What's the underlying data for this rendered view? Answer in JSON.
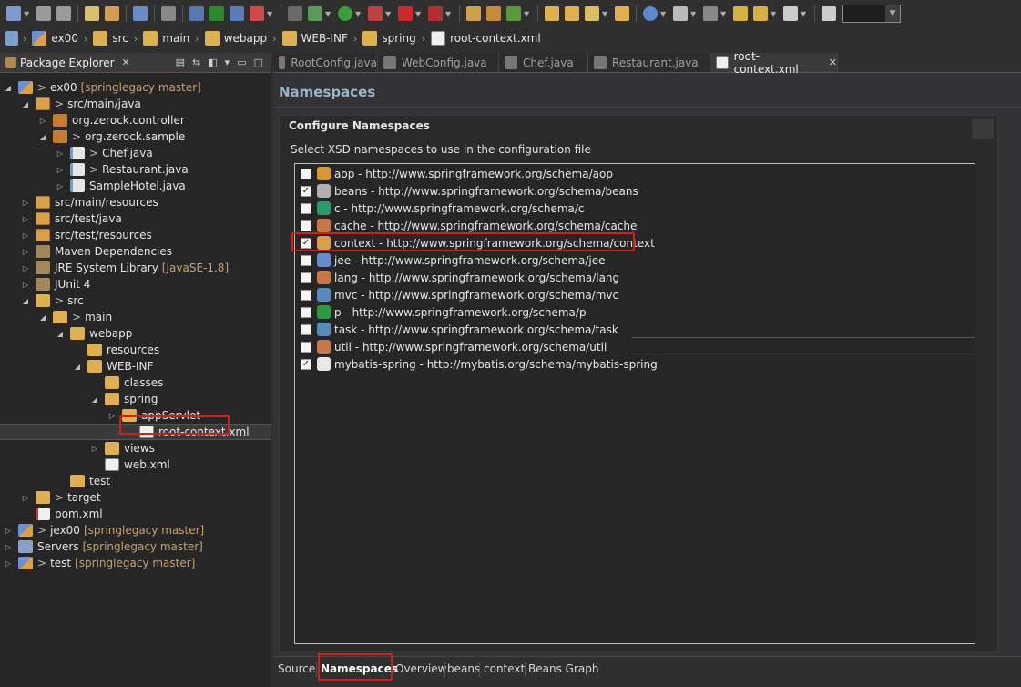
{
  "breadcrumb": [
    "ex00",
    "src",
    "main",
    "webapp",
    "WEB-INF",
    "spring",
    "root-context.xml"
  ],
  "explorer": {
    "title": "Package Explorer",
    "items": [
      {
        "label": "ex00",
        "deco": "[springlegacy master]",
        "prefix": ">",
        "icon": "project-icon",
        "arrow": "expanded"
      },
      {
        "label": "src/main/java",
        "prefix": ">",
        "icon": "source-folder-icon",
        "arrow": "expanded"
      },
      {
        "label": "org.zerock.controller",
        "icon": "package-icon",
        "arrow": "collapsed"
      },
      {
        "label": "org.zerock.sample",
        "prefix": ">",
        "icon": "package-icon",
        "arrow": "expanded"
      },
      {
        "label": "Chef.java",
        "prefix": ">",
        "icon": "java-file-icon",
        "arrow": "collapsed"
      },
      {
        "label": "Restaurant.java",
        "prefix": ">",
        "icon": "java-file-icon",
        "arrow": "collapsed"
      },
      {
        "label": "SampleHotel.java",
        "icon": "java-file-icon",
        "arrow": "collapsed"
      },
      {
        "label": "src/main/resources",
        "icon": "source-folder-icon",
        "arrow": "collapsed"
      },
      {
        "label": "src/test/java",
        "icon": "source-folder-icon",
        "arrow": "collapsed"
      },
      {
        "label": "src/test/resources",
        "icon": "source-folder-icon",
        "arrow": "collapsed"
      },
      {
        "label": "Maven Dependencies",
        "icon": "library-icon",
        "arrow": "collapsed"
      },
      {
        "label": "JRE System Library",
        "deco": "[JavaSE-1.8]",
        "icon": "library-icon",
        "arrow": "collapsed"
      },
      {
        "label": "JUnit 4",
        "icon": "library-icon",
        "arrow": "collapsed"
      },
      {
        "label": "src",
        "prefix": ">",
        "icon": "folder-icon",
        "arrow": "expanded"
      },
      {
        "label": "main",
        "prefix": ">",
        "icon": "folder-icon",
        "arrow": "expanded"
      },
      {
        "label": "webapp",
        "icon": "folder-icon",
        "arrow": "expanded"
      },
      {
        "label": "resources",
        "icon": "folder-icon",
        "arrow": "none"
      },
      {
        "label": "WEB-INF",
        "icon": "folder-icon",
        "arrow": "expanded"
      },
      {
        "label": "classes",
        "icon": "folder-icon",
        "arrow": "none"
      },
      {
        "label": "spring",
        "icon": "folder-icon",
        "arrow": "expanded"
      },
      {
        "label": "appServlet",
        "icon": "folder-icon",
        "arrow": "collapsed"
      },
      {
        "label": "root-context.xml",
        "icon": "xml-file-icon",
        "arrow": "none",
        "selected": true
      },
      {
        "label": "views",
        "icon": "folder-icon",
        "arrow": "collapsed"
      },
      {
        "label": "web.xml",
        "icon": "xml-file-icon",
        "arrow": "none"
      },
      {
        "label": "test",
        "icon": "folder-icon",
        "arrow": "none"
      },
      {
        "label": "target",
        "prefix": ">",
        "icon": "folder-icon",
        "arrow": "collapsed"
      },
      {
        "label": "pom.xml",
        "icon": "pom-file-icon",
        "arrow": "none"
      },
      {
        "label": "jex00",
        "deco": "[springlegacy master]",
        "prefix": ">",
        "icon": "project-icon",
        "arrow": "collapsed"
      },
      {
        "label": "Servers",
        "deco": "[springlegacy master]",
        "icon": "server-icon",
        "arrow": "collapsed"
      },
      {
        "label": "test",
        "deco": "[springlegacy master]",
        "prefix": ">",
        "icon": "project-icon",
        "arrow": "collapsed"
      }
    ]
  },
  "tabs": [
    "RootConfig.java",
    "WebConfig.java",
    "Chef.java",
    "Restaurant.java",
    "root-context.xml"
  ],
  "active_tab": "root-context.xml",
  "editor": {
    "title": "Namespaces",
    "section_title": "Configure Namespaces",
    "description": "Select XSD namespaces to use in the configuration file"
  },
  "namespaces": [
    {
      "label": "aop - http://www.springframework.org/schema/aop",
      "checked": false,
      "mark": ""
    },
    {
      "label": "beans - http://www.springframework.org/schema/beans",
      "checked": true,
      "mark": "✓"
    },
    {
      "label": "c - http://www.springframework.org/schema/c",
      "checked": false,
      "mark": ""
    },
    {
      "label": "cache - http://www.springframework.org/schema/cache",
      "checked": false,
      "mark": ""
    },
    {
      "label": "context - http://www.springframework.org/schema/context",
      "checked": true,
      "mark": "✓"
    },
    {
      "label": "jee - http://www.springframework.org/schema/jee",
      "checked": false,
      "mark": ""
    },
    {
      "label": "lang - http://www.springframework.org/schema/lang",
      "checked": false,
      "mark": ""
    },
    {
      "label": "mvc - http://www.springframework.org/schema/mvc",
      "checked": false,
      "mark": ""
    },
    {
      "label": "p - http://www.springframework.org/schema/p",
      "checked": false,
      "mark": ""
    },
    {
      "label": "task - http://www.springframework.org/schema/task",
      "checked": false,
      "mark": ""
    },
    {
      "label": "util - http://www.springframework.org/schema/util",
      "checked": false,
      "mark": ""
    },
    {
      "label": "mybatis-spring - http://mybatis.org/schema/mybatis-spring",
      "checked": true,
      "mark": "✓"
    }
  ],
  "bottom_tabs": [
    "Source",
    "Namespaces",
    "Overview",
    "beans",
    "context",
    "Beans Graph"
  ],
  "active_bottom_tab": "Namespaces",
  "colors": {
    "highlight": "#e01818",
    "title": "#9ab4cc",
    "decoration": "#c8a26a"
  }
}
